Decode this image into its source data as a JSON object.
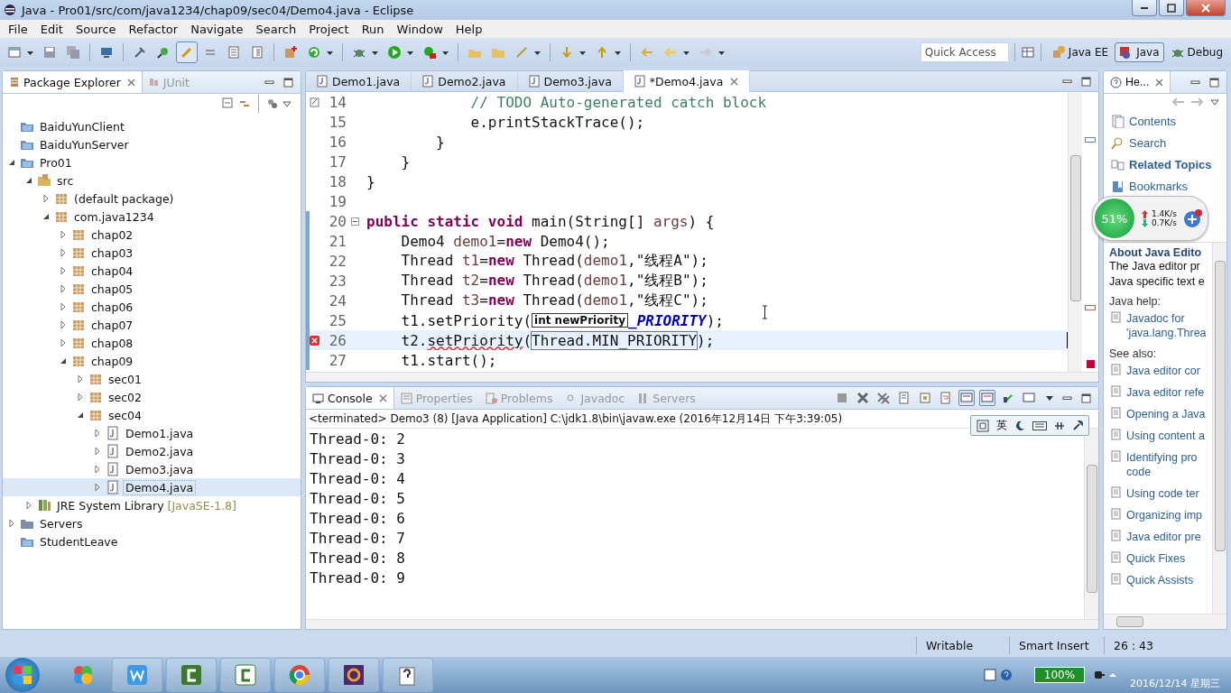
{
  "window": {
    "title": "Java - Pro01/src/com/java1234/chap09/sec04/Demo4.java - Eclipse"
  },
  "menu": [
    "File",
    "Edit",
    "Source",
    "Refactor",
    "Navigate",
    "Search",
    "Project",
    "Run",
    "Window",
    "Help"
  ],
  "toolbar": {
    "quick_access": {
      "placeholder": "Quick Access"
    },
    "perspectives": [
      {
        "label": "Java EE",
        "selected": false
      },
      {
        "label": "Java",
        "selected": true
      },
      {
        "label": "Debug",
        "selected": false
      }
    ]
  },
  "package_explorer": {
    "tabs": [
      {
        "label": "Package Explorer",
        "selected": true
      },
      {
        "label": "JUnit",
        "selected": false
      }
    ],
    "tree": [
      {
        "label": "BaiduYunClient",
        "kind": "project",
        "selected": false
      },
      {
        "label": "BaiduYunServer",
        "kind": "project",
        "selected": false
      },
      {
        "label": "Pro01",
        "kind": "project",
        "expanded": true,
        "selected": false,
        "children": [
          {
            "label": "src",
            "kind": "source",
            "expanded": true,
            "selected": false,
            "children": [
              {
                "label": "(default package)",
                "kind": "package",
                "expanded": false,
                "selected": false
              },
              {
                "label": "com.java1234",
                "kind": "package",
                "expanded": true,
                "selected": false,
                "children": [
                  {
                    "label": "chap02",
                    "kind": "package",
                    "expanded": false,
                    "selected": false
                  },
                  {
                    "label": "chap03",
                    "kind": "package",
                    "expanded": false,
                    "selected": false
                  },
                  {
                    "label": "chap04",
                    "kind": "package",
                    "expanded": false,
                    "selected": false
                  },
                  {
                    "label": "chap05",
                    "kind": "package",
                    "expanded": false,
                    "selected": false
                  },
                  {
                    "label": "chap06",
                    "kind": "package",
                    "expanded": false,
                    "selected": false
                  },
                  {
                    "label": "chap07",
                    "kind": "package",
                    "expanded": false,
                    "selected": false
                  },
                  {
                    "label": "chap08",
                    "kind": "package",
                    "expanded": false,
                    "selected": false
                  },
                  {
                    "label": "chap09",
                    "kind": "package",
                    "expanded": true,
                    "selected": false,
                    "children": [
                      {
                        "label": "sec01",
                        "kind": "package",
                        "expanded": false,
                        "selected": false
                      },
                      {
                        "label": "sec02",
                        "kind": "package",
                        "expanded": false,
                        "selected": false
                      },
                      {
                        "label": "sec04",
                        "kind": "package",
                        "expanded": true,
                        "selected": false,
                        "children": [
                          {
                            "label": "Demo1.java",
                            "kind": "file",
                            "expanded": false,
                            "selected": false
                          },
                          {
                            "label": "Demo2.java",
                            "kind": "file",
                            "expanded": false,
                            "selected": false
                          },
                          {
                            "label": "Demo3.java",
                            "kind": "file",
                            "expanded": false,
                            "selected": false
                          },
                          {
                            "label": "Demo4.java",
                            "kind": "file",
                            "expanded": false,
                            "selected": true
                          }
                        ]
                      }
                    ]
                  }
                ]
              }
            ]
          },
          {
            "label": "JRE System Library",
            "decoration": "[JavaSE-1.8]",
            "kind": "library",
            "expanded": false,
            "selected": false
          }
        ]
      },
      {
        "label": "Servers",
        "kind": "folder",
        "expanded": false,
        "selected": false
      },
      {
        "label": "StudentLeave",
        "kind": "project",
        "selected": false
      }
    ]
  },
  "editor": {
    "tabs": [
      {
        "label": "Demo1.java",
        "selected": false
      },
      {
        "label": "Demo2.java",
        "selected": false
      },
      {
        "label": "Demo3.java",
        "selected": false
      },
      {
        "label": "*Demo4.java",
        "selected": true
      }
    ],
    "lines": [
      {
        "number": "14",
        "kind": "task",
        "current": false,
        "changed": false,
        "tokens": [
          {
            "kind": "comment",
            "text": "            // TODO Auto-generated catch block"
          }
        ]
      },
      {
        "number": "15",
        "kind": "plain",
        "current": false,
        "changed": false,
        "tokens": [
          {
            "kind": "plain",
            "text": "            e.printStackTrace();"
          }
        ]
      },
      {
        "number": "16",
        "kind": "plain",
        "current": false,
        "changed": false,
        "tokens": [
          {
            "kind": "plain",
            "text": "        }"
          }
        ]
      },
      {
        "number": "17",
        "kind": "plain",
        "current": false,
        "changed": false,
        "tokens": [
          {
            "kind": "plain",
            "text": "    }"
          }
        ]
      },
      {
        "number": "18",
        "kind": "plain",
        "current": false,
        "changed": false,
        "tokens": [
          {
            "kind": "plain",
            "text": "}"
          }
        ]
      },
      {
        "number": "19",
        "kind": "plain",
        "current": false,
        "changed": false
      },
      {
        "number": "20",
        "kind": "fold",
        "current": false,
        "changed": true,
        "tokens": [
          {
            "kind": "keyword",
            "text": "public static void "
          },
          {
            "kind": "plain",
            "text": "main(String[] "
          },
          {
            "kind": "local",
            "text": "args"
          },
          {
            "kind": "plain",
            "text": ") {"
          }
        ]
      },
      {
        "number": "21",
        "kind": "plain",
        "current": false,
        "changed": true,
        "tokens": [
          {
            "kind": "plain",
            "text": "    Demo4 "
          },
          {
            "kind": "local",
            "text": "demo1"
          },
          {
            "kind": "plain",
            "text": "="
          },
          {
            "kind": "keyword",
            "text": "new"
          },
          {
            "kind": "plain",
            "text": " Demo4();"
          }
        ]
      },
      {
        "number": "22",
        "kind": "plain",
        "current": false,
        "changed": true,
        "tokens": [
          {
            "kind": "plain",
            "text": "    Thread "
          },
          {
            "kind": "local",
            "text": "t1"
          },
          {
            "kind": "plain",
            "text": "="
          },
          {
            "kind": "keyword",
            "text": "new"
          },
          {
            "kind": "plain",
            "text": " Thread("
          },
          {
            "kind": "local",
            "text": "demo1"
          },
          {
            "kind": "plain",
            "text": ",\"线程A\");"
          }
        ]
      },
      {
        "number": "23",
        "kind": "plain",
        "current": false,
        "changed": true,
        "tokens": [
          {
            "kind": "plain",
            "text": "    Thread "
          },
          {
            "kind": "local",
            "text": "t2"
          },
          {
            "kind": "plain",
            "text": "="
          },
          {
            "kind": "keyword",
            "text": "new"
          },
          {
            "kind": "plain",
            "text": " Thread("
          },
          {
            "kind": "local",
            "text": "demo1"
          },
          {
            "kind": "plain",
            "text": ",\"线程B\");"
          }
        ]
      },
      {
        "number": "24",
        "kind": "plain",
        "current": false,
        "changed": true,
        "tokens": [
          {
            "kind": "plain",
            "text": "    Thread "
          },
          {
            "kind": "local",
            "text": "t3"
          },
          {
            "kind": "plain",
            "text": "="
          },
          {
            "kind": "keyword",
            "text": "new"
          },
          {
            "kind": "plain",
            "text": " Thread("
          },
          {
            "kind": "local",
            "text": "demo1"
          },
          {
            "kind": "plain",
            "text": ",\"线程C\");"
          }
        ]
      },
      {
        "number": "25",
        "kind": "plain",
        "current": false,
        "changed": true,
        "tokens": [
          {
            "kind": "plain",
            "text": "    t1.setPriority("
          },
          {
            "kind": "hint",
            "text": "int newPriority"
          },
          {
            "kind": "field",
            "text": "_PRIORITY"
          },
          {
            "kind": "plain",
            "text": ");"
          }
        ]
      },
      {
        "number": "26",
        "kind": "error",
        "current": true,
        "changed": true,
        "tokens": [
          {
            "kind": "plain",
            "text": "    t2."
          },
          {
            "kind": "error",
            "text": "setPriority"
          },
          {
            "kind": "plain",
            "text": "("
          },
          {
            "kind": "linked",
            "text": "Thread.MIN_PRIORITY"
          },
          {
            "kind": "plain",
            "text": ");"
          }
        ]
      },
      {
        "number": "27",
        "kind": "plain",
        "current": false,
        "changed": true,
        "tokens": [
          {
            "kind": "plain",
            "text": "    t1.start();"
          }
        ]
      }
    ]
  },
  "console": {
    "tabs": [
      {
        "label": "Console",
        "selected": true
      },
      {
        "label": "Properties",
        "selected": false
      },
      {
        "label": "Problems",
        "selected": false
      },
      {
        "label": "Javadoc",
        "selected": false
      },
      {
        "label": "Servers",
        "selected": false
      }
    ],
    "header": "<terminated> Demo3 (8) [Java Application] C:\\jdk1.8\\bin\\javaw.exe (2016年12月14日 下午3:39:05)",
    "lines": [
      "Thread-0: 2",
      "Thread-0: 3",
      "Thread-0: 4",
      "Thread-0: 5",
      "Thread-0: 6",
      "Thread-0: 7",
      "Thread-0: 8",
      "Thread-0: 9"
    ]
  },
  "help": {
    "tab": "He...",
    "nav": [
      {
        "label": "Contents",
        "kind": "contents",
        "selected": false
      },
      {
        "label": "Search",
        "kind": "search",
        "selected": false
      },
      {
        "label": "Related Topics",
        "kind": "related",
        "selected": true
      },
      {
        "label": "Bookmarks",
        "kind": "bookmarks",
        "selected": false
      }
    ],
    "title": "About Java Edito",
    "intro": [
      "The Java editor pr",
      "Java specific text e"
    ],
    "sections": [
      {
        "heading": "Java help:",
        "links": [
          "Javadoc for 'java.lang.Threa"
        ]
      },
      {
        "heading": "See also:",
        "links": [
          "Java editor cor",
          "Java editor refe",
          "Opening a Java",
          "Using content a",
          "Identifying pro code",
          "Using code ter",
          "Organizing imp",
          "Java editor pre",
          "Quick Fixes",
          "Quick Assists"
        ]
      }
    ]
  },
  "status_bar": [
    "Writable",
    "Smart Insert",
    "26 : 43"
  ],
  "net_widget": {
    "percent": "51%",
    "up": "1.4K/s",
    "down": "0.7K/s"
  },
  "ime_bar": {
    "mode": "英"
  },
  "taskbar": {
    "battery": "100%",
    "date": "2016/12/14 星期三"
  }
}
